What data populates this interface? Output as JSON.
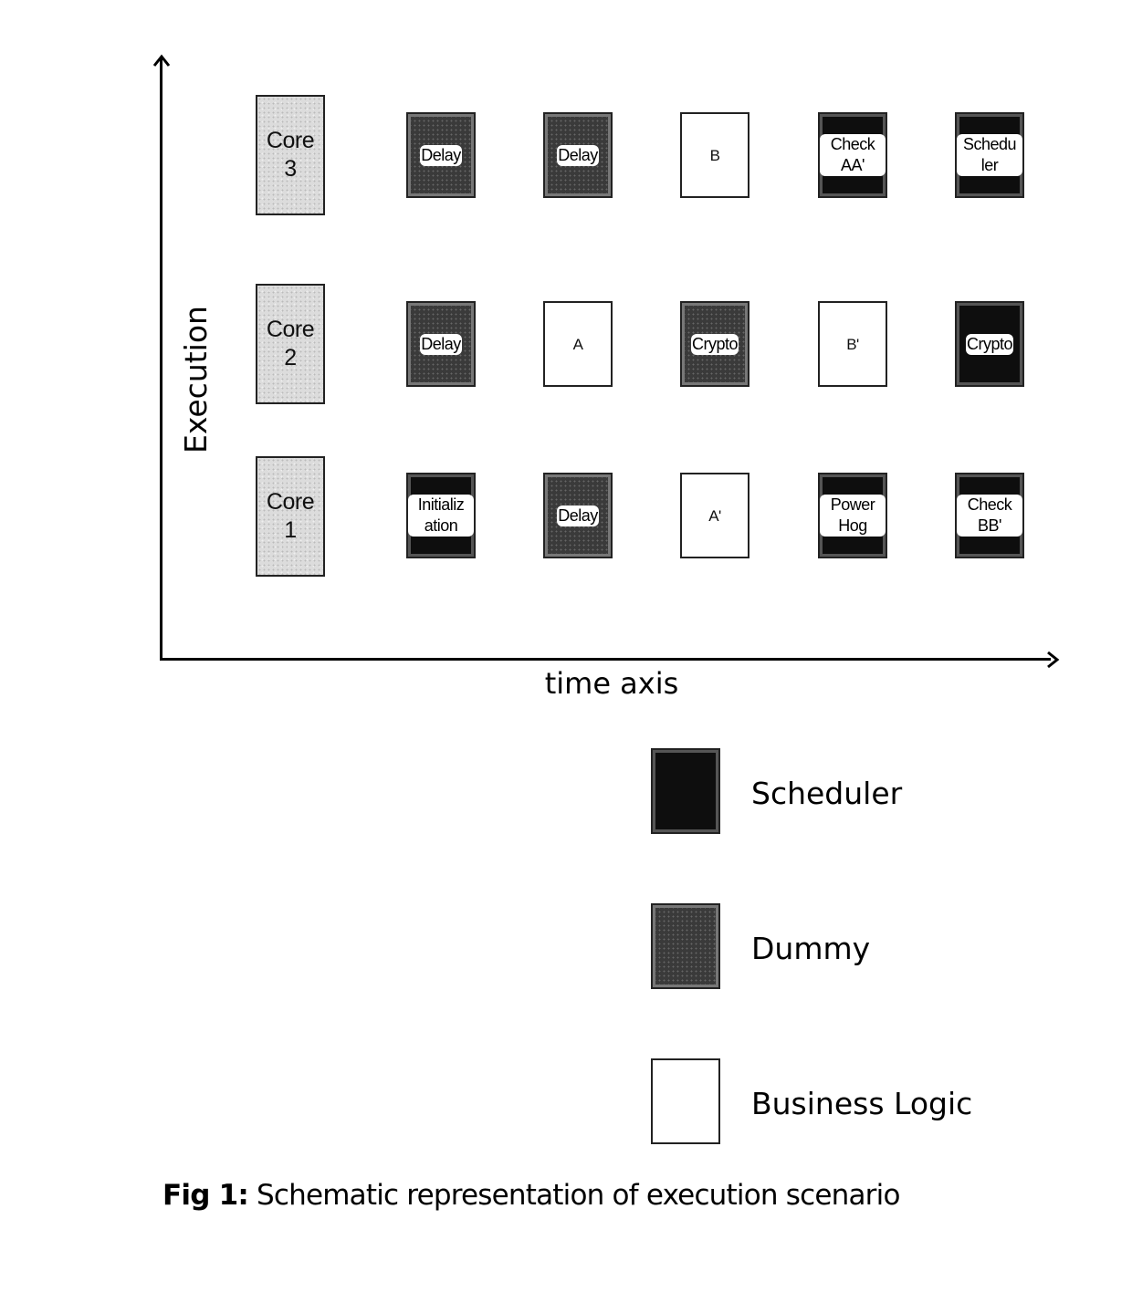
{
  "axes": {
    "y_label": "Execution",
    "x_label": "time axis"
  },
  "rows": [
    {
      "core_label_line1": "Core",
      "core_label_line2": "3",
      "tasks": [
        {
          "label": "Delay",
          "type": "dummy"
        },
        {
          "label": "Delay",
          "type": "dummy"
        },
        {
          "label": "B",
          "type": "business"
        },
        {
          "label": "Check AA'",
          "type": "scheduler"
        },
        {
          "label": "Schedu ler",
          "type": "scheduler"
        }
      ]
    },
    {
      "core_label_line1": "Core",
      "core_label_line2": "2",
      "tasks": [
        {
          "label": "Delay",
          "type": "dummy"
        },
        {
          "label": "A",
          "type": "business"
        },
        {
          "label": "Crypto",
          "type": "dummy"
        },
        {
          "label": "B'",
          "type": "business"
        },
        {
          "label": "Crypto",
          "type": "scheduler"
        }
      ]
    },
    {
      "core_label_line1": "Core",
      "core_label_line2": "1",
      "tasks": [
        {
          "label": "Initializ ation",
          "type": "scheduler"
        },
        {
          "label": "Delay",
          "type": "dummy"
        },
        {
          "label": "A'",
          "type": "business"
        },
        {
          "label": "Power Hog",
          "type": "scheduler"
        },
        {
          "label": "Check BB'",
          "type": "scheduler"
        }
      ]
    }
  ],
  "legend": [
    {
      "label": "Scheduler",
      "type": "scheduler"
    },
    {
      "label": "Dummy",
      "type": "dummy"
    },
    {
      "label": "Business Logic",
      "type": "business"
    }
  ],
  "caption": {
    "prefix": "Fig 1:",
    "text": " Schematic representation of execution scenario"
  }
}
